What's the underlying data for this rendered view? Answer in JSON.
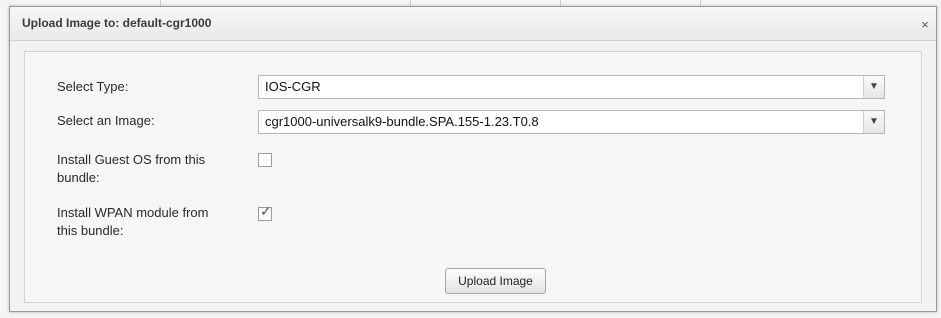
{
  "dialog": {
    "title": "Upload Image to: default-cgr1000",
    "close_label": "×"
  },
  "form": {
    "type_label": "Select Type:",
    "type_value": "IOS-CGR",
    "image_label": "Select an Image:",
    "image_value": "cgr1000-universalk9-bundle.SPA.155-1.23.T0.8",
    "guest_os_label_line1": "Install Guest OS from this",
    "guest_os_label_line2": "bundle:",
    "guest_os_checked": false,
    "wpan_label_line1": "Install WPAN module from",
    "wpan_label_line2": "this bundle:",
    "wpan_checked": true,
    "upload_button": "Upload Image"
  },
  "icons": {
    "dropdown": "chevron-down-icon",
    "close": "close-icon",
    "check": "checkmark-icon"
  },
  "colors": {
    "checkmark": "#2b4fa3",
    "dialog_bg": "#f2f2f2"
  }
}
